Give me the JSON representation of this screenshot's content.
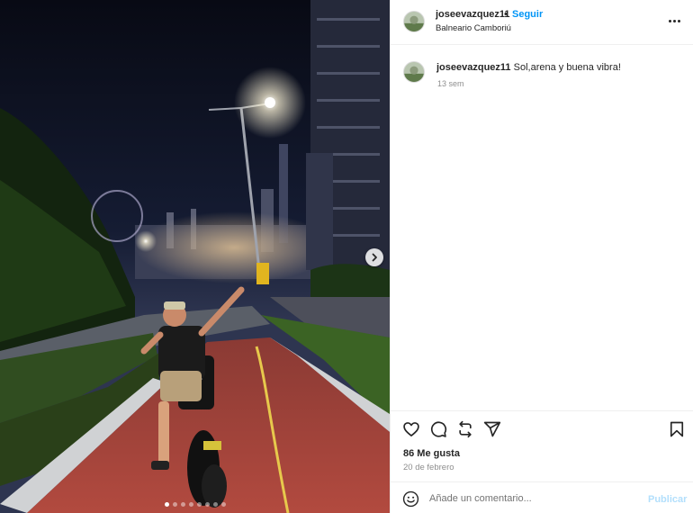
{
  "post": {
    "username": "joseevazquez11",
    "separator": "•",
    "follow_label": "Seguir",
    "location": "Balneario Camboriú",
    "more_icon": "more-options-icon"
  },
  "caption": {
    "username": "joseevazquez11",
    "text": "Sol,arena y buena vibra!",
    "time_ago": "13 sem"
  },
  "actions": {
    "icons": [
      "heart-icon",
      "comment-icon",
      "share-icon",
      "send-icon",
      "bookmark-icon"
    ]
  },
  "likes": "86 Me gusta",
  "date": "20 de febrero",
  "comment": {
    "placeholder": "Añade un comentario...",
    "publish_label": "Publicar",
    "emoji_icon": "emoji-icon"
  },
  "carousel": {
    "slide_count": 8,
    "active_slide": 1
  },
  "colors": {
    "link_blue": "#0095f6",
    "publish_disabled": "#b2dffc",
    "muted_text": "#8e8e8e"
  }
}
